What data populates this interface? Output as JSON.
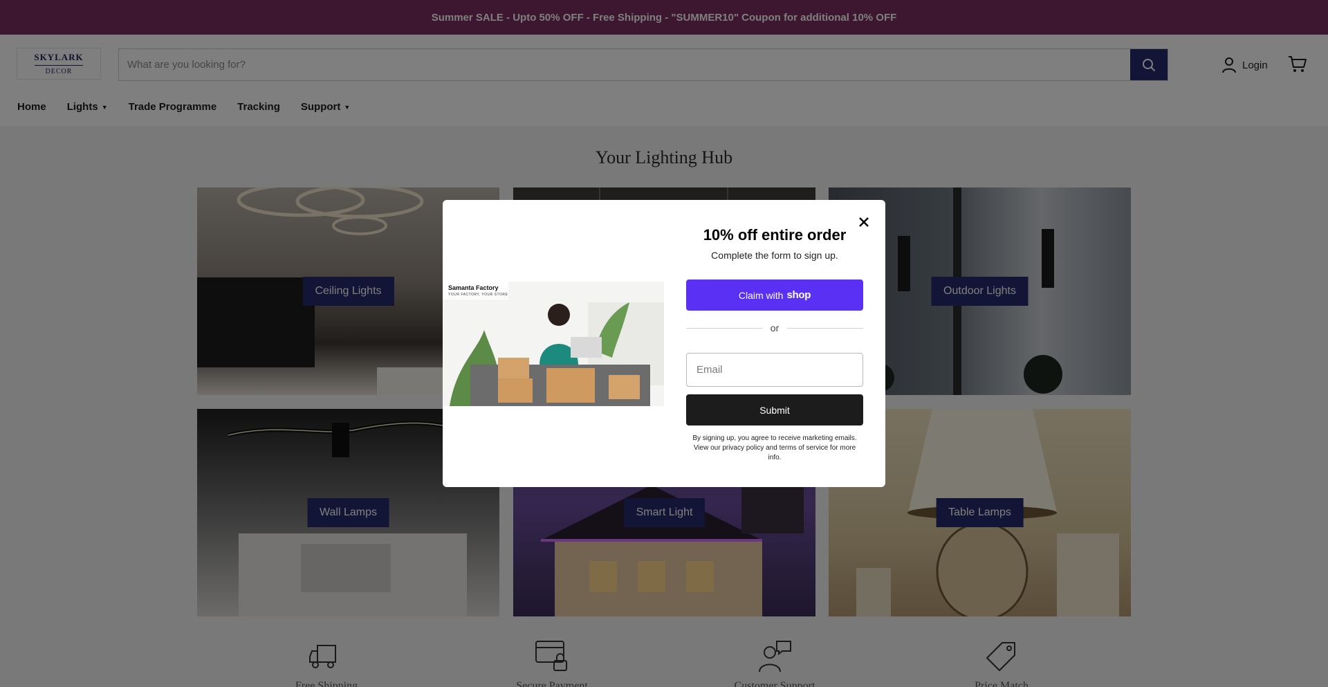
{
  "announcement": "Summer SALE - Upto 50% OFF - Free Shipping - \"SUMMER10\" Coupon for additional 10% OFF",
  "header": {
    "logo": {
      "line1": "SKYLARK",
      "line2": "DECOR"
    },
    "search": {
      "placeholder": "What are you looking for?",
      "icon": "search-icon"
    },
    "login_label": "Login",
    "cart_icon": "cart-icon"
  },
  "nav": {
    "items": [
      {
        "label": "Home",
        "dropdown": false
      },
      {
        "label": "Lights",
        "dropdown": true
      },
      {
        "label": "Trade Programme",
        "dropdown": false
      },
      {
        "label": "Tracking",
        "dropdown": false
      },
      {
        "label": "Support",
        "dropdown": true
      }
    ]
  },
  "main": {
    "title": "Your Lighting Hub",
    "categories": [
      {
        "label": "Ceiling Lights"
      },
      {
        "label": ""
      },
      {
        "label": "Outdoor Lights"
      },
      {
        "label": "Wall Lamps"
      },
      {
        "label": "Smart Light"
      },
      {
        "label": "Table Lamps"
      }
    ],
    "features": [
      {
        "icon": "truck-icon",
        "label": "Free Shipping"
      },
      {
        "icon": "secure-card-icon",
        "label": "Secure Payment"
      },
      {
        "icon": "customer-support-icon",
        "label": "Customer Support"
      },
      {
        "icon": "price-tag-icon",
        "label": "Price Match"
      }
    ]
  },
  "modal": {
    "image_brand": "Samanta Factory",
    "image_tagline": "YOUR FACTORY, YOUR STORE",
    "title": "10% off entire order",
    "subtitle": "Complete the form to sign up.",
    "claim_label": "Claim with",
    "claim_brand": "shop",
    "or_label": "or",
    "email_placeholder": "Email",
    "submit_label": "Submit",
    "legal": "By signing up, you agree to receive marketing emails. View our privacy policy and terms of service for more info."
  },
  "colors": {
    "announcement_bg": "#7a2f5f",
    "accent_navy": "#262a6e",
    "shop_purple": "#5a31f4",
    "submit_dark": "#1c1c1c"
  }
}
